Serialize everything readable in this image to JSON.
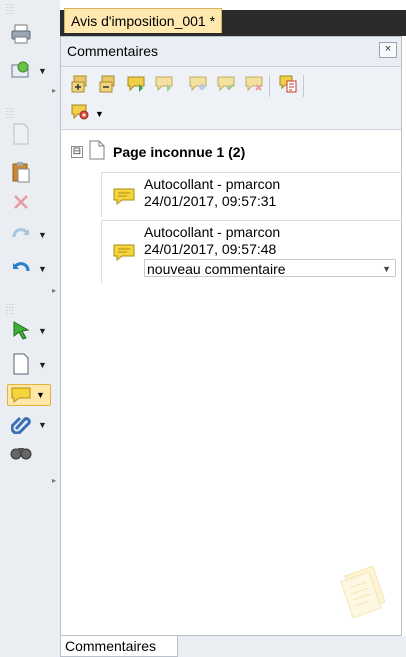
{
  "document_tab": {
    "title": "Avis d'imposition_001 *"
  },
  "panel": {
    "title": "Commentaires",
    "close_glyph": "×"
  },
  "tree": {
    "page_label": "Page inconnue 1 (2)",
    "expander_glyph": "⊟",
    "comments": [
      {
        "author_line": "Autocollant - pmarcon",
        "date_line": "24/01/2017, 09:57:31",
        "reply": ""
      },
      {
        "author_line": "Autocollant - pmarcon",
        "date_line": "24/01/2017, 09:57:48",
        "reply": "nouveau commentaire"
      }
    ]
  },
  "bottom_tab": {
    "label": "Commentaires"
  },
  "left_toolbar": {
    "icons": [
      "print-icon",
      "send-icon",
      "page-icon",
      "paste-icon",
      "delete-icon",
      "redo-icon",
      "undo-icon",
      "select-arrow-icon",
      "new-page-icon",
      "comment-note-icon",
      "attach-icon",
      "search-binoculars-icon"
    ]
  },
  "colors": {
    "accent_tab": "#ffe9b0",
    "note_yellow": "#f5d43c",
    "toolbar_bg": "#eaeef3"
  }
}
